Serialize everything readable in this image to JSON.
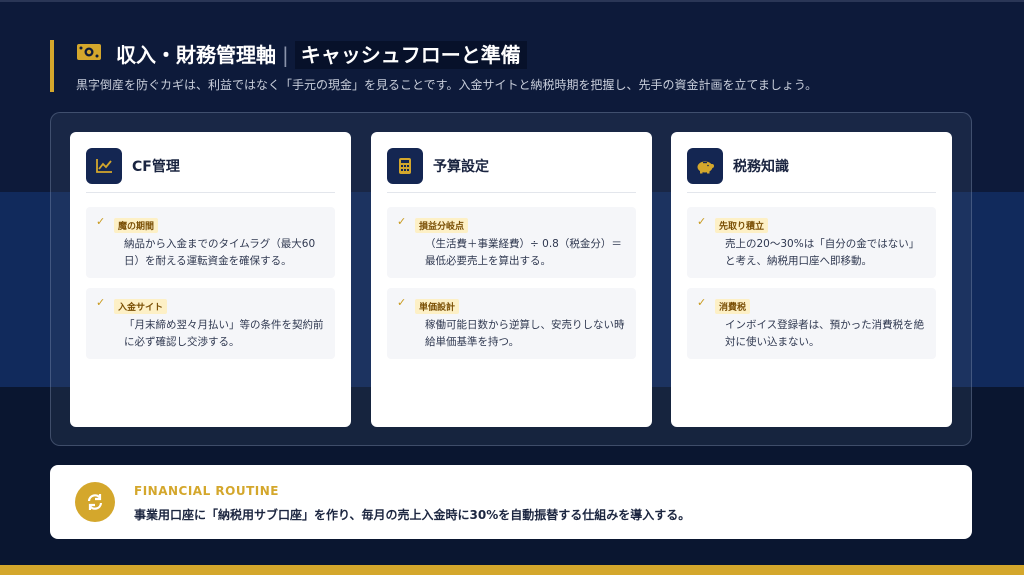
{
  "header": {
    "title_main": "収入・財務管理軸",
    "title_highlight": "キャッシュフローと準備",
    "subtitle": "黒字倒産を防ぐカギは、利益ではなく「手元の現金」を見ることです。入金サイトと納税時期を把握し、先手の資金計画を立てましょう。",
    "icon": "money-bill-icon"
  },
  "cards": [
    {
      "title": "CF管理",
      "icon": "chart-line-icon",
      "items": [
        {
          "tag": "魔の期間",
          "text": "納品から入金までのタイムラグ（最大60日）を耐える運転資金を確保する。"
        },
        {
          "tag": "入金サイト",
          "text": "「月末締め翌々月払い」等の条件を契約前に必ず確認し交渉する。"
        }
      ]
    },
    {
      "title": "予算設定",
      "icon": "calculator-icon",
      "items": [
        {
          "tag": "損益分岐点",
          "text": "（生活費＋事業経費）÷ 0.8（税金分）＝最低必要売上を算出する。"
        },
        {
          "tag": "単価設計",
          "text": "稼働可能日数から逆算し、安売りしない時給単価基準を持つ。"
        }
      ]
    },
    {
      "title": "税務知識",
      "icon": "piggy-bank-icon",
      "items": [
        {
          "tag": "先取り積立",
          "text": "売上の20〜30%は「自分の金ではない」と考え、納税用口座へ即移動。"
        },
        {
          "tag": "消費税",
          "text": "インボイス登録者は、預かった消費税を絶対に使い込まない。"
        }
      ]
    }
  ],
  "routine": {
    "label": "FINANCIAL ROUTINE",
    "text": "事業用口座に「納税用サブ口座」を作り、毎月の売上入金時に30%を自動振替する仕組みを導入する。",
    "icon": "sync-icon"
  },
  "colors": {
    "background": "#0d1a3a",
    "accent": "#d4a72c",
    "card_icon_bg": "#142652",
    "tag_bg": "#fdf0c6"
  }
}
